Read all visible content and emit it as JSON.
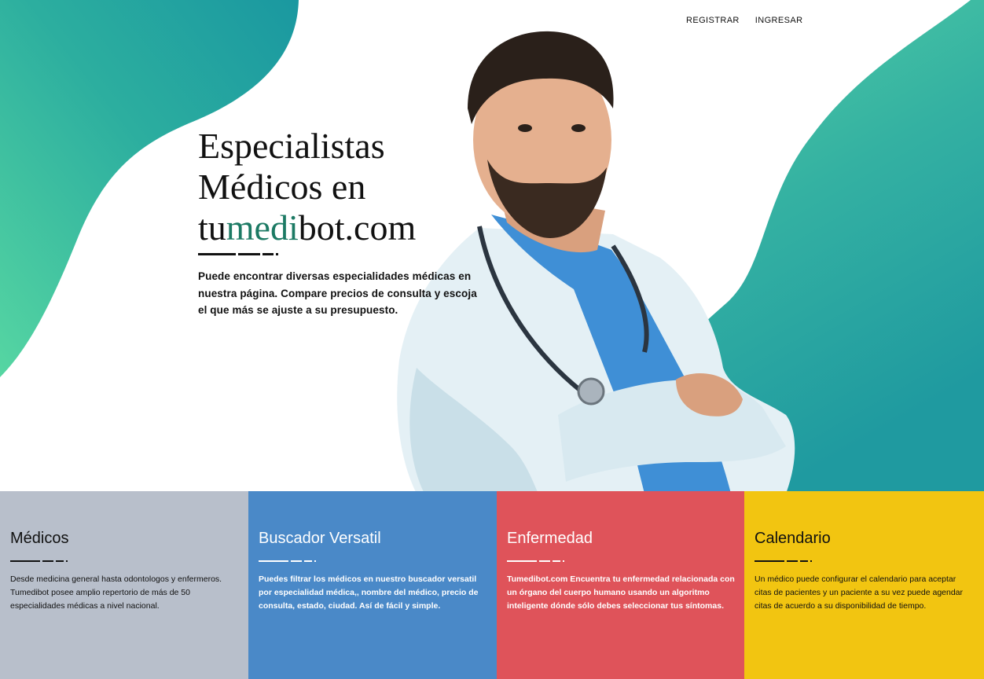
{
  "nav": {
    "register_label": "REGISTRAR",
    "login_label": "INGRESAR"
  },
  "hero": {
    "headline_line1": "Especialistas",
    "headline_line2": "Médicos en",
    "brand_prefix": "tu",
    "brand_accent": "medi",
    "brand_suffix": "bot.com",
    "description": "Puede encontrar diversas especialidades médicas en nuestra página. Compare  precios de consulta y escoja el que más se ajuste a su presupuesto."
  },
  "features": [
    {
      "title": "Médicos",
      "text": "Desde medicina general  hasta odontologos y enfermeros. Tumedibot posee amplio repertorio de más de 50 especialidades médicas a nivel nacional."
    },
    {
      "title": "Buscador Versatil",
      "text": "Puedes filtrar los médicos en nuestro buscador versatil por especialidad médica,, nombre del médico, precio de consulta, estado, ciudad. Así de fácil y simple."
    },
    {
      "title": "Enfermedad",
      "text": "Tumedibot.com Encuentra tu enfermedad relacionada con un órgano del cuerpo humano usando un algoritmo inteligente dónde sólo debes seleccionar tus síntomas."
    },
    {
      "title": "Calendario",
      "text": "Un médico puede configurar el calendario para aceptar citas de pacientes y un paciente a su vez puede agendar citas de acuerdo a su disponibilidad de tiempo."
    }
  ],
  "colors": {
    "brand_accent": "#1c7a64",
    "blob_light": "#52d1a5",
    "blob_dark": "#1c9aa0",
    "card_gray": "#b8bfcb",
    "card_blue": "#4a89c8",
    "card_red": "#df535a",
    "card_yellow": "#f2c511"
  }
}
